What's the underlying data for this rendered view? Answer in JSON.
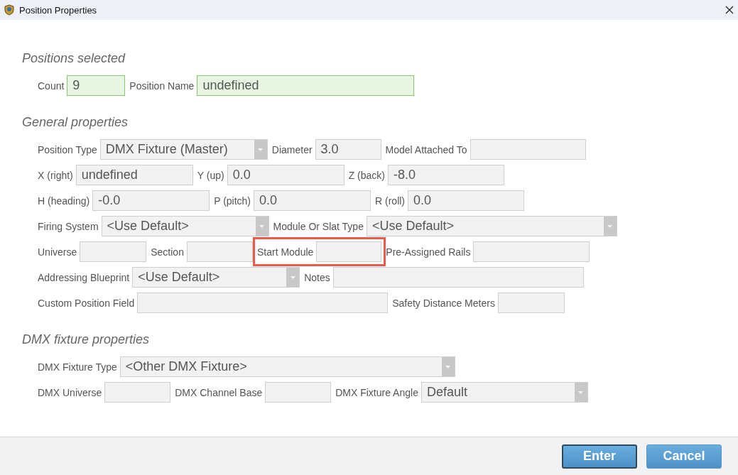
{
  "window": {
    "title": "Position Properties"
  },
  "sections": [
    {
      "title": "Positions selected",
      "rows": [
        [
          {
            "kind": "text",
            "label": "Count",
            "value": "9",
            "modified": true
          },
          {
            "kind": "text",
            "label": "Position Name",
            "value": "undefined",
            "modified": true
          }
        ]
      ]
    },
    {
      "title": "General properties",
      "rows": [
        [
          {
            "kind": "select",
            "label": "Position Type",
            "value": "DMX Fixture (Master)"
          },
          {
            "kind": "text",
            "label": "Diameter",
            "value": "3.0"
          },
          {
            "kind": "text",
            "label": "Model Attached To"
          }
        ],
        [
          {
            "kind": "text",
            "label": "X (right)",
            "value": "undefined"
          },
          {
            "kind": "text",
            "label": "Y (up)",
            "value": "0.0"
          },
          {
            "kind": "text",
            "label": "Z (back)",
            "value": "-8.0"
          }
        ],
        [
          {
            "kind": "text",
            "label": "H (heading)",
            "value": "-0.0"
          },
          {
            "kind": "text",
            "label": "P (pitch)",
            "value": "0.0"
          },
          {
            "kind": "text",
            "label": "R (roll)",
            "value": "0.0"
          }
        ],
        [
          {
            "kind": "select",
            "label": "Firing System",
            "value": "<Use Default>"
          },
          {
            "kind": "select",
            "label": "Module Or Slat Type",
            "value": "<Use Default>"
          }
        ],
        [
          {
            "kind": "text",
            "label": "Universe",
            "highlighted": false
          },
          {
            "kind": "text",
            "label": "Section",
            "highlighted": false
          },
          {
            "kind": "text",
            "label": "Start Module",
            "highlighted": true
          },
          {
            "kind": "text",
            "label": "Pre-Assigned Rails",
            "highlighted": false
          }
        ],
        [
          {
            "kind": "select",
            "label": "Addressing Blueprint",
            "value": "<Use Default>"
          },
          {
            "kind": "text",
            "label": "Notes"
          }
        ],
        [
          {
            "kind": "text",
            "label": "Custom Position Field"
          },
          {
            "kind": "text",
            "label": "Safety Distance Meters"
          }
        ]
      ]
    },
    {
      "title": "DMX fixture properties",
      "rows": [
        [
          {
            "kind": "select",
            "label": "DMX Fixture Type",
            "value": "<Other DMX Fixture>"
          }
        ],
        [
          {
            "kind": "text",
            "label": "DMX Universe"
          },
          {
            "kind": "text",
            "label": "DMX Channel Base"
          },
          {
            "kind": "select",
            "label": "DMX Fixture Angle",
            "value": "Default"
          }
        ]
      ]
    }
  ],
  "buttons": [
    {
      "label": "Enter",
      "default": true
    },
    {
      "label": "Cancel",
      "default": false
    }
  ]
}
